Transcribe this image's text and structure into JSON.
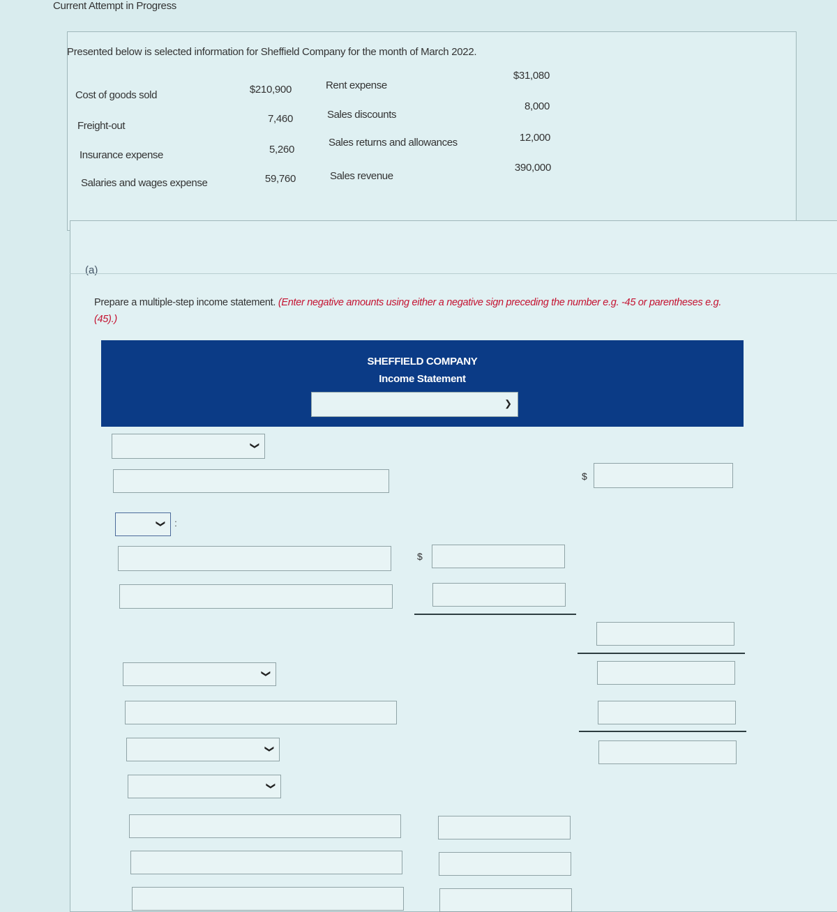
{
  "header": {
    "attempt_label": "Current Attempt in Progress"
  },
  "problem": {
    "intro": "Presented below is selected information for Sheffield Company for the month of March 2022.",
    "left_items": [
      {
        "label": "Cost of goods sold",
        "value": "$210,900"
      },
      {
        "label": "Freight-out",
        "value": "7,460"
      },
      {
        "label": "Insurance expense",
        "value": "5,260"
      },
      {
        "label": "Salaries and wages expense",
        "value": "59,760"
      }
    ],
    "right_items": [
      {
        "label": "Rent expense",
        "value": "$31,080"
      },
      {
        "label": "Sales discounts",
        "value": "8,000"
      },
      {
        "label": "Sales returns and allowances",
        "value": "12,000"
      },
      {
        "label": "Sales revenue",
        "value": "390,000"
      }
    ]
  },
  "part_a": {
    "label": "(a)",
    "instruction_main": "Prepare a multiple-step income statement.",
    "instruction_note": "(Enter negative amounts using either a negative sign preceding the number e.g. -45 or parentheses e.g. (45).)"
  },
  "statement": {
    "company": "SHEFFIELD COMPANY",
    "title": "Income Statement",
    "period_select": {
      "value": "",
      "icon": "chevron-down-icon"
    },
    "currency_symbol": "$",
    "colon": ":"
  }
}
